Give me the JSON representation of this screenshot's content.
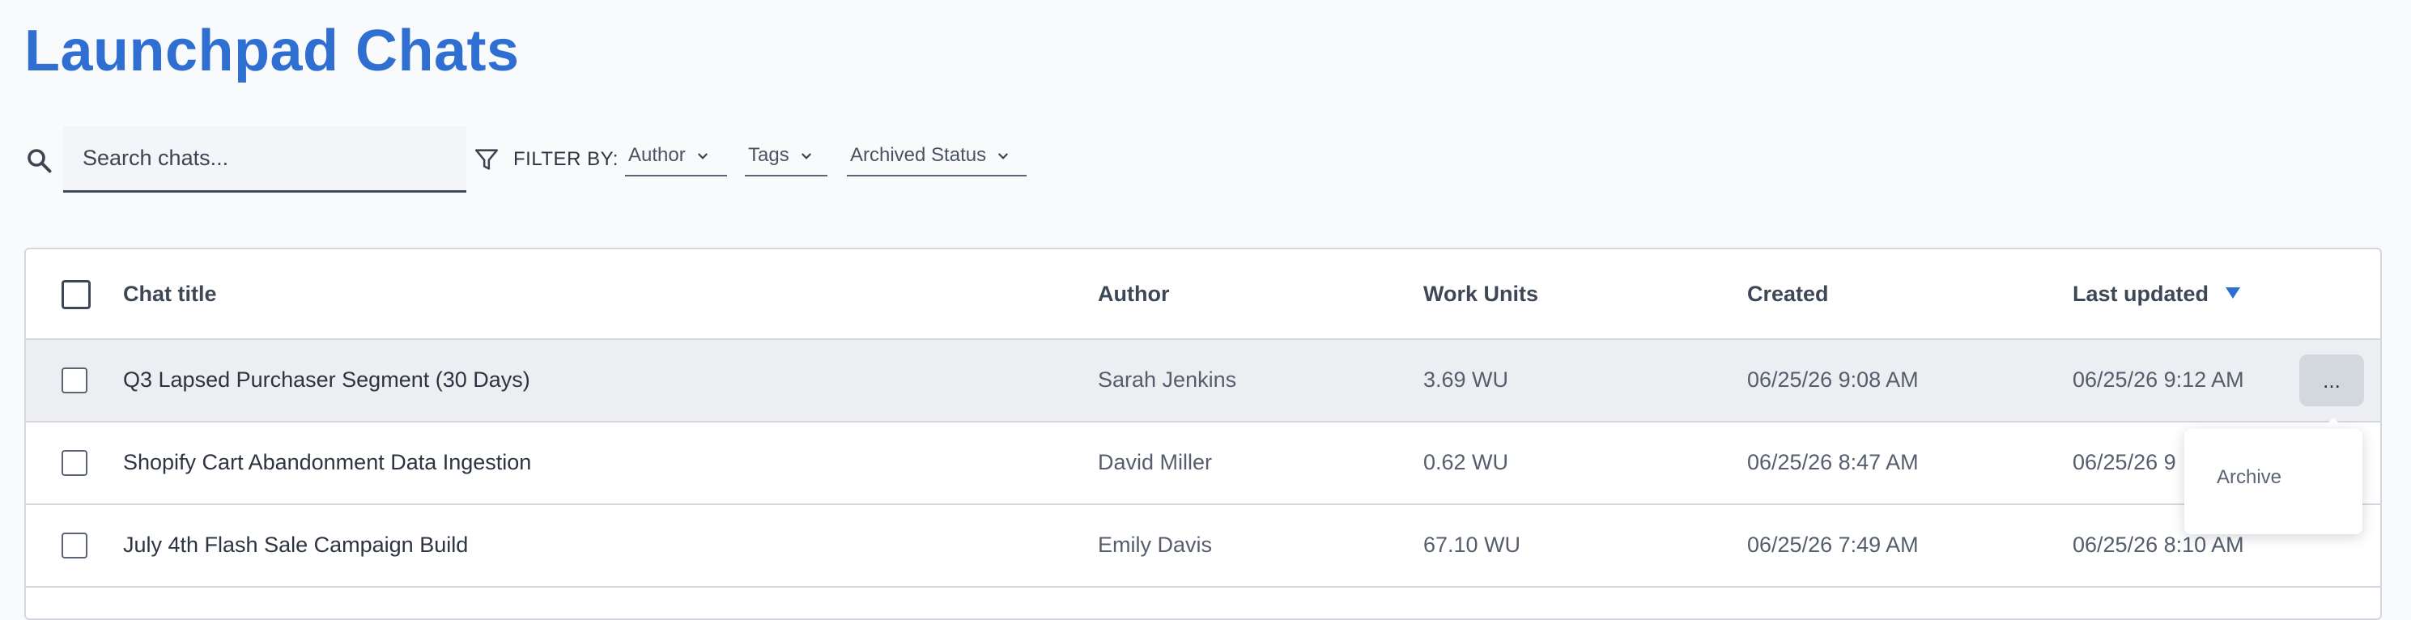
{
  "page": {
    "title": "Launchpad Chats"
  },
  "search": {
    "placeholder": "Search chats..."
  },
  "filters": {
    "label": "FILTER BY:",
    "items": [
      {
        "label": "Author"
      },
      {
        "label": "Tags"
      },
      {
        "label": "Archived Status"
      }
    ]
  },
  "table": {
    "headers": {
      "title": "Chat title",
      "author": "Author",
      "work_units": "Work Units",
      "created": "Created",
      "last_updated": "Last updated"
    },
    "sort": {
      "column": "last_updated",
      "direction": "descending"
    },
    "rows": [
      {
        "title": "Q3 Lapsed Purchaser Segment (30 Days)",
        "author": "Sarah Jenkins",
        "work_units": "3.69 WU",
        "created": "06/25/26 9:08 AM",
        "last_updated": "06/25/26 9:12 AM",
        "highlighted": true
      },
      {
        "title": "Shopify Cart Abandonment Data Ingestion",
        "author": "David Miller",
        "work_units": "0.62 WU",
        "created": "06/25/26 8:47 AM",
        "last_updated": "06/25/26 9"
      },
      {
        "title": "July 4th Flash Sale Campaign Build",
        "author": "Emily Davis",
        "work_units": "67.10 WU",
        "created": "06/25/26 7:49 AM",
        "last_updated": "06/25/26 8:10 AM"
      }
    ],
    "row_menu": {
      "button_label": "...",
      "items": [
        {
          "label": "Archive"
        }
      ]
    }
  },
  "colors": {
    "accent": "#2f6fd1",
    "background": "#f9fafc",
    "highlight_row": "#eceef1"
  },
  "icons": [
    "search-icon",
    "filter-icon",
    "chevron-down-icon",
    "sort-descending-icon"
  ]
}
